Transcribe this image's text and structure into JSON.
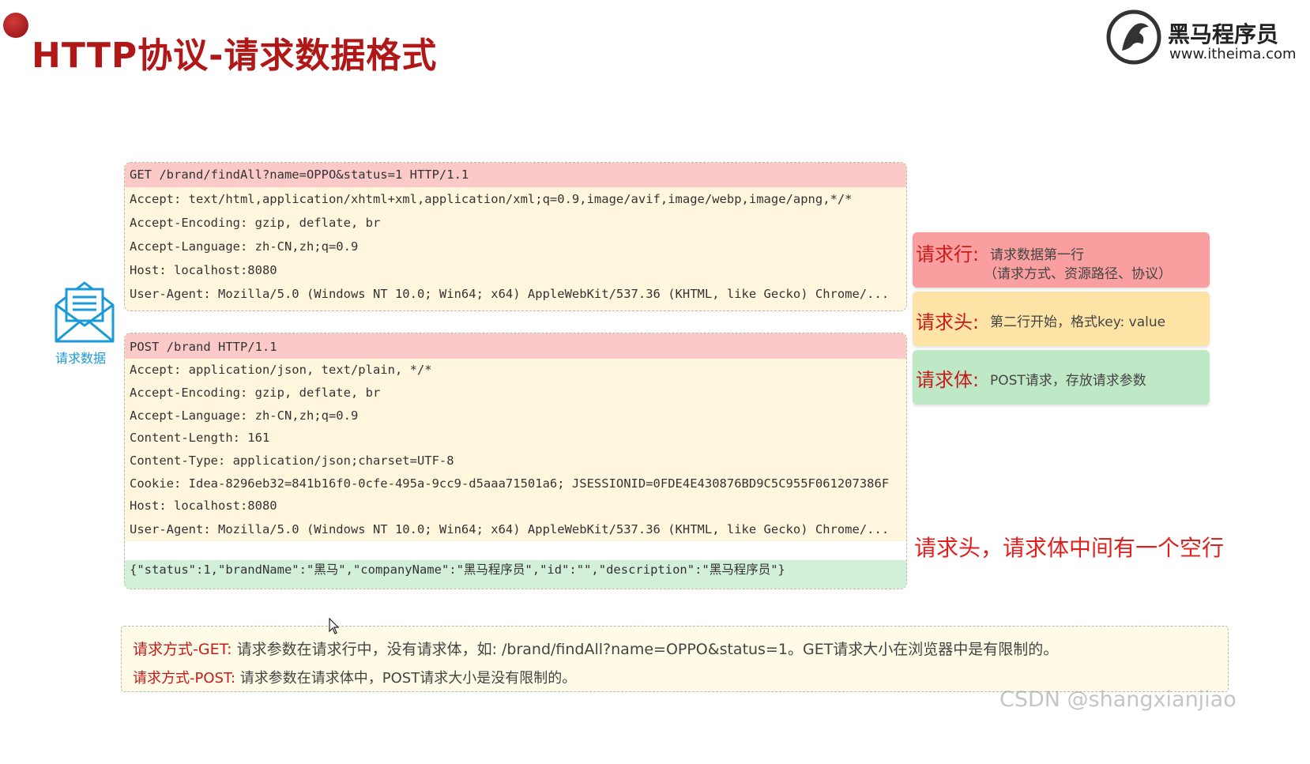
{
  "header": {
    "title": "HTTP协议-请求数据格式",
    "logo_name": "黑马程序员",
    "logo_url": "www.itheima.com"
  },
  "sidebar_icon": {
    "label": "请求数据",
    "icon": "envelope-document-icon"
  },
  "get_request": {
    "request_line": "GET /brand/findAll?name=OPPO&status=1 HTTP/1.1",
    "headers": [
      "Accept: text/html,application/xhtml+xml,application/xml;q=0.9,image/avif,image/webp,image/apng,*/*",
      "Accept-Encoding: gzip, deflate, br",
      "Accept-Language: zh-CN,zh;q=0.9",
      "Host: localhost:8080",
      "User-Agent: Mozilla/5.0 (Windows NT 10.0; Win64; x64) AppleWebKit/537.36 (KHTML, like Gecko) Chrome/..."
    ]
  },
  "post_request": {
    "request_line": "POST /brand HTTP/1.1",
    "headers": [
      "Accept: application/json, text/plain, */*",
      "Accept-Encoding: gzip, deflate, br",
      "Accept-Language: zh-CN,zh;q=0.9",
      "Content-Length: 161",
      "Content-Type: application/json;charset=UTF-8",
      "Cookie: Idea-8296eb32=841b16f0-0cfe-495a-9cc9-d5aaa71501a6; JSESSIONID=0FDE4E430876BD9C5C955F061207386F",
      "Host: localhost:8080",
      "User-Agent: Mozilla/5.0 (Windows NT 10.0; Win64; x64) AppleWebKit/537.36 (KHTML, like Gecko) Chrome/..."
    ],
    "body": "{\"status\":1,\"brandName\":\"黑马\",\"companyName\":\"黑马程序员\",\"id\":\"\",\"description\":\"黑马程序员\"}"
  },
  "legend": {
    "request_line_key": "请求行:",
    "request_line_desc_1": "请求数据第一行",
    "request_line_desc_2": "（请求方式、资源路径、协议）",
    "request_header_key": "请求头:",
    "request_header_desc": "第二行开始，格式key: value",
    "request_body_key": "请求体:",
    "request_body_desc": "POST请求，存放请求参数"
  },
  "blank_line_note": "请求头，请求体中间有一个空行",
  "notes": {
    "get_key": "请求方式-GET:",
    "get_text": "请求参数在请求行中，没有请求体，如: /brand/findAll?name=OPPO&status=1。GET请求大小在浏览器中是有限制的。",
    "post_key": "请求方式-POST:",
    "post_text": "请求参数在请求体中，POST请求大小是没有限制的。"
  },
  "watermark": "CSDN @shangxianjiao",
  "colors": {
    "title_red": "#b01818",
    "request_line_bg": "#fcc9c9",
    "header_bg": "#fff7dd",
    "body_bg": "#d2efd9",
    "accent_blue": "#1a9ad6"
  }
}
